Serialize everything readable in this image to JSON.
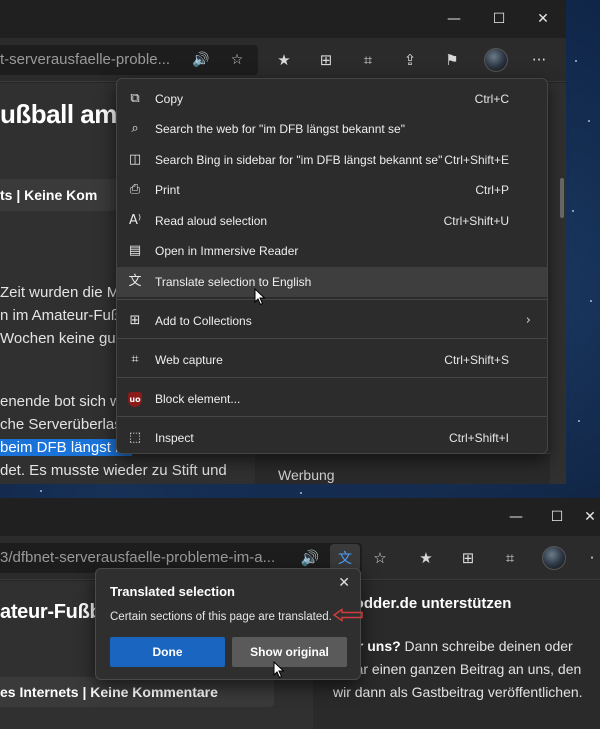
{
  "window1": {
    "address_text": "t-serverausfaelle-proble...",
    "page": {
      "title_fragment": "ußball am",
      "meta_text": "ts  |  Keine Kom",
      "lines": [
        "Zeit wurden die M",
        "n im Amateur-Fuß",
        "Wochen keine gute",
        "enende bot sich w",
        "che Serverüberlas",
        "beim DFB längst be",
        "det. Es musste wieder zu Stift und"
      ],
      "ad_label": "Werbung"
    },
    "context_menu": {
      "items": [
        {
          "label": "Copy",
          "shortcut": "Ctrl+C",
          "icon": "copy-icon",
          "glyph": "⧉"
        },
        {
          "label": "Search the web for \"im DFB längst bekannt se\"",
          "shortcut": "",
          "icon": "search-icon",
          "glyph": "⌕"
        },
        {
          "label": "Search Bing in sidebar for \"im DFB längst bekannt se\"",
          "shortcut": "Ctrl+Shift+E",
          "icon": "sidebar-search-icon",
          "glyph": "◫"
        },
        {
          "label": "Print",
          "shortcut": "Ctrl+P",
          "icon": "print-icon",
          "glyph": "⎙"
        },
        {
          "label": "Read aloud selection",
          "shortcut": "Ctrl+Shift+U",
          "icon": "read-aloud-icon",
          "glyph": "A⁾"
        },
        {
          "label": "Open in Immersive Reader",
          "shortcut": "",
          "icon": "immersive-reader-icon",
          "glyph": "▤"
        },
        {
          "label": "Translate selection to English",
          "shortcut": "",
          "icon": "translate-icon",
          "glyph": "文"
        },
        {
          "label": "Add to Collections",
          "shortcut": "",
          "icon": "collections-icon",
          "glyph": "⊞"
        },
        {
          "label": "Web capture",
          "shortcut": "Ctrl+Shift+S",
          "icon": "web-capture-icon",
          "glyph": "⌗"
        },
        {
          "label": "Block element...",
          "shortcut": "",
          "icon": "ublock-icon",
          "glyph": "uo"
        },
        {
          "label": "Inspect",
          "shortcut": "Ctrl+Shift+I",
          "icon": "inspect-icon",
          "glyph": "⬚"
        }
      ]
    }
  },
  "window2": {
    "address_text": "3/dfbnet-serverausfaelle-probleme-im-a...",
    "page": {
      "title_fragment": "ateur-Fußball",
      "meta_text": "es Internets  |  Keine Kommentare",
      "side_title": "kmodder.de unterstützen",
      "side_bold": "s für uns?",
      "side_text": " Dann schreibe deinen oder sogar einen ganzen Beitrag an uns, den wir dann als Gastbeitrag veröffentlichen."
    },
    "popup": {
      "title": "Translated selection",
      "text": "Certain sections of this page are translated.",
      "done_label": "Done",
      "show_original_label": "Show original"
    }
  },
  "colors": {
    "accent_blue": "#1a65c0",
    "selection": "#1a73d9",
    "annotation_red": "#d33a3a"
  }
}
